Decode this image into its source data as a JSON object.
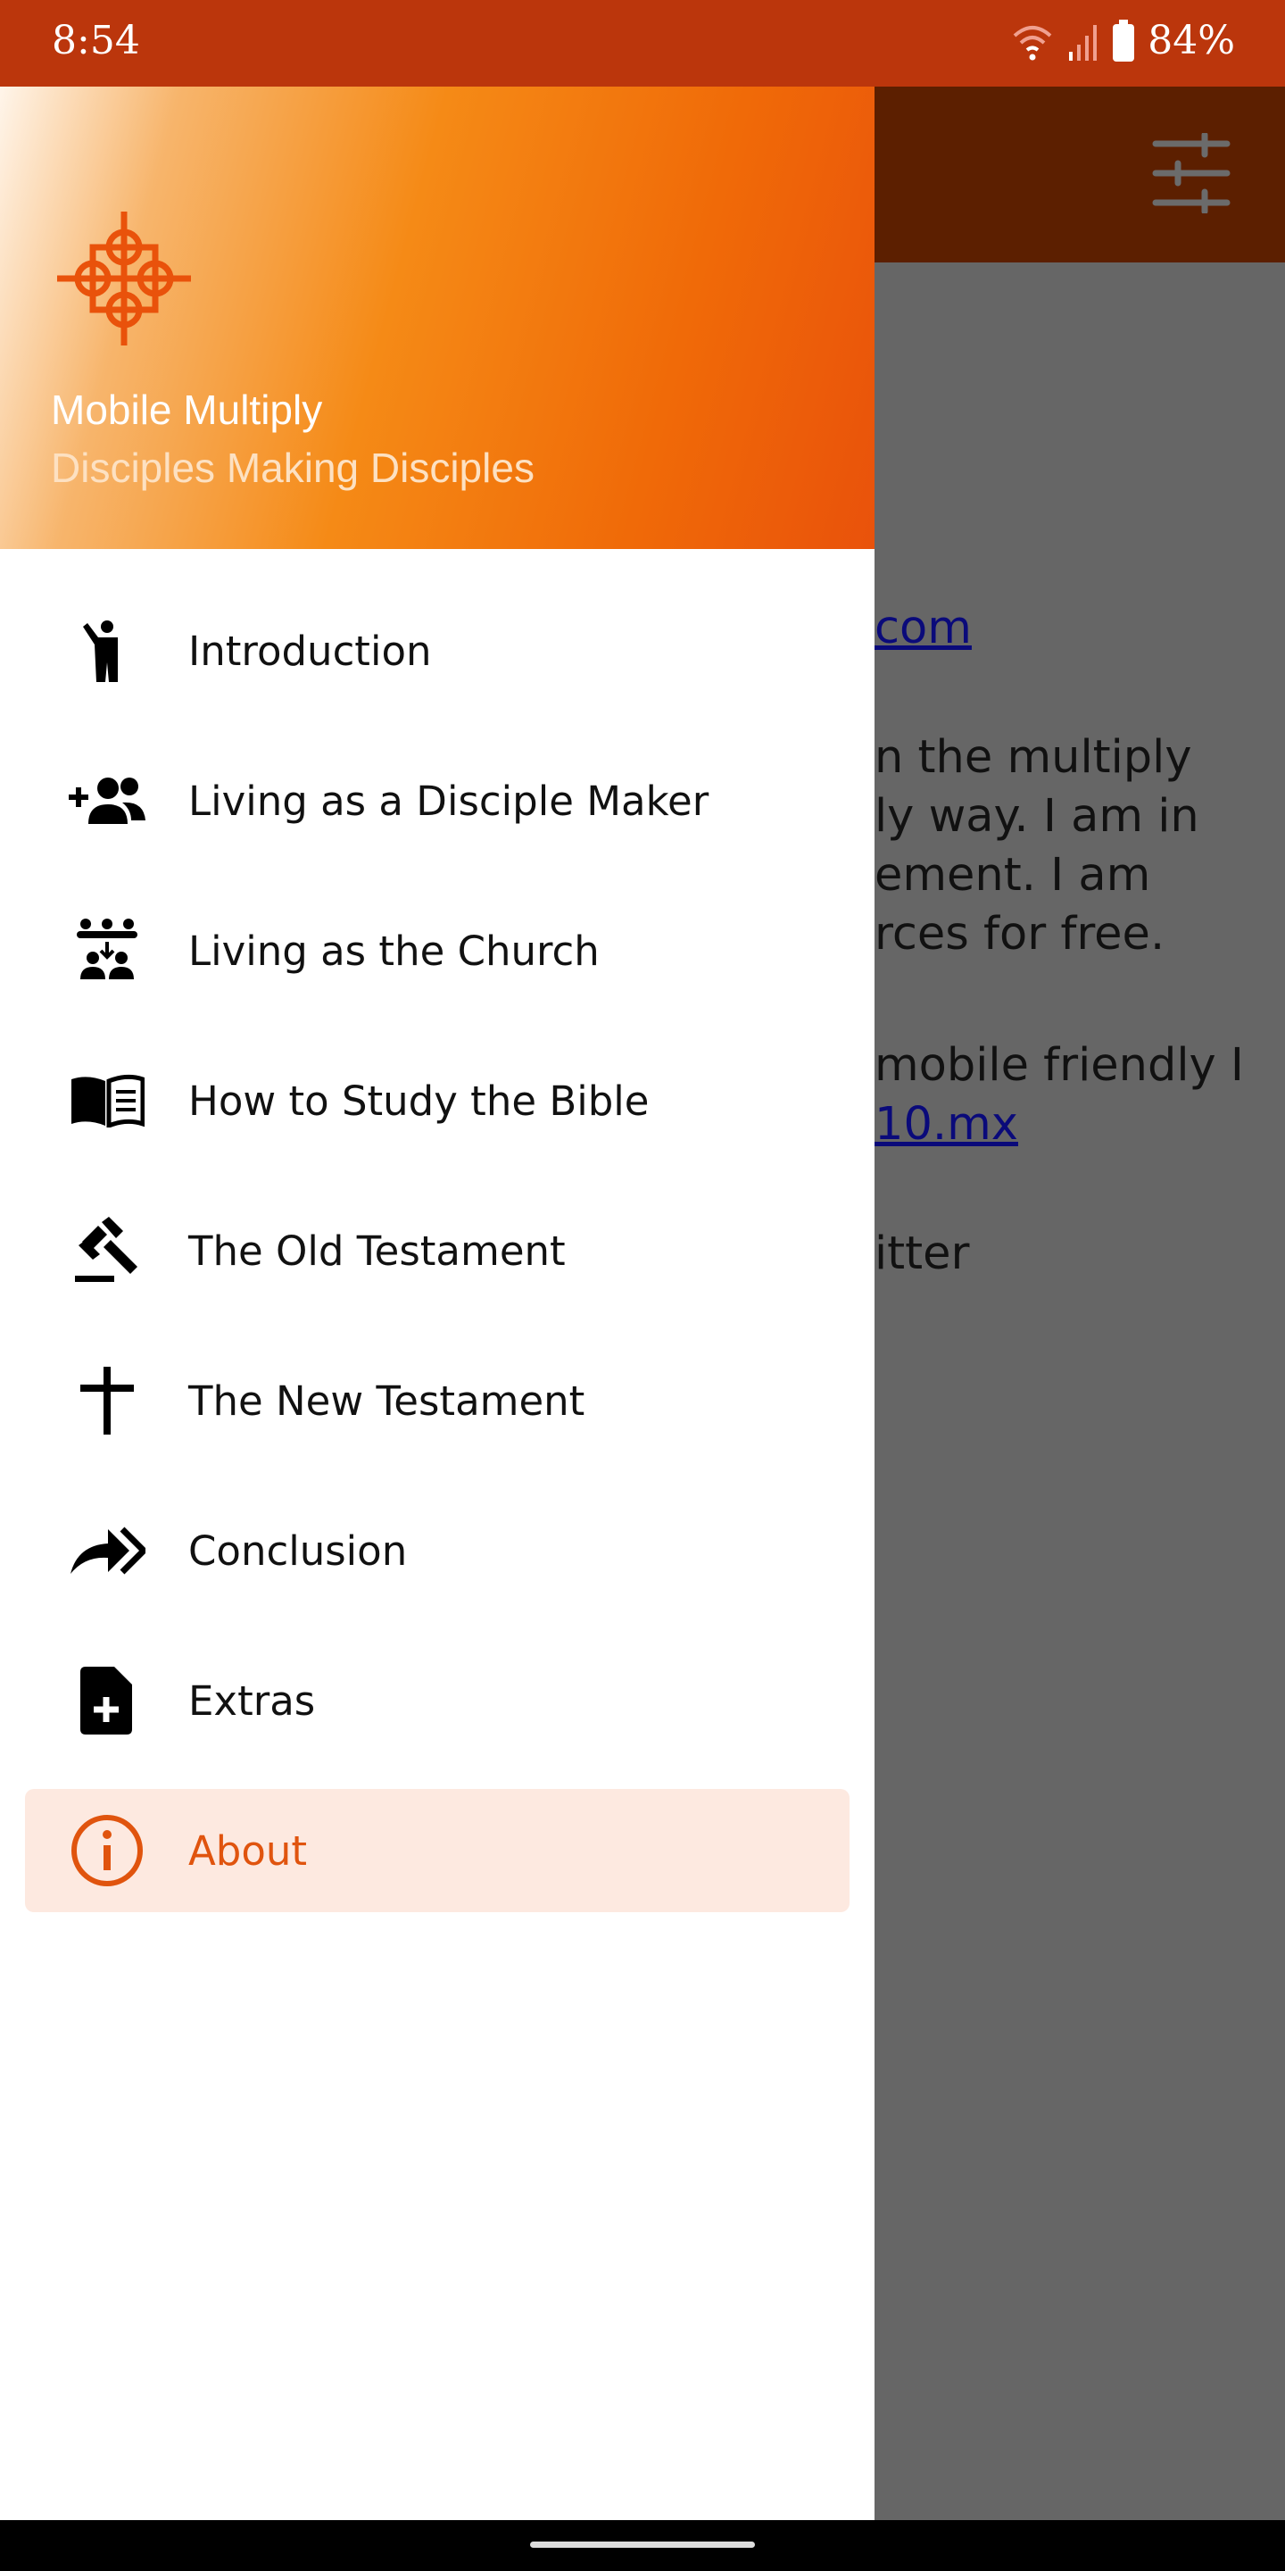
{
  "status_bar": {
    "time": "8:54",
    "battery": "84%",
    "icons": [
      "wifi-icon",
      "signal-icon",
      "battery-icon"
    ]
  },
  "app_bar": {
    "icon": "tune-icon"
  },
  "background_content": {
    "lines": [
      {
        "text": "com",
        "link": true
      },
      {
        "text": "n the multiply",
        "link": false
      },
      {
        "text": "ly way. I am in",
        "link": false
      },
      {
        "text": "ement. I am",
        "link": false
      },
      {
        "text": "rces for free.",
        "link": false
      },
      {
        "text": "mobile friendly I",
        "link": false
      },
      {
        "text": "10.mx",
        "link": true
      },
      {
        "text": "itter",
        "link": false
      }
    ]
  },
  "drawer": {
    "title": "Mobile Multiply",
    "subtitle": "Disciples Making Disciples",
    "accent": "#e0540e",
    "items": [
      {
        "label": "Introduction",
        "icon": "person-waving-icon"
      },
      {
        "label": "Living as a Disciple Maker",
        "icon": "group-add-icon"
      },
      {
        "label": "Living as the Church",
        "icon": "church-group-icon"
      },
      {
        "label": "How to Study the Bible",
        "icon": "open-book-icon"
      },
      {
        "label": "The Old Testament",
        "icon": "gavel-icon"
      },
      {
        "label": "The New Testament",
        "icon": "cross-icon"
      },
      {
        "label": "Conclusion",
        "icon": "double-arrow-forward-icon"
      },
      {
        "label": "Extras",
        "icon": "file-add-icon"
      },
      {
        "label": "About",
        "icon": "info-icon",
        "selected": true
      }
    ]
  }
}
